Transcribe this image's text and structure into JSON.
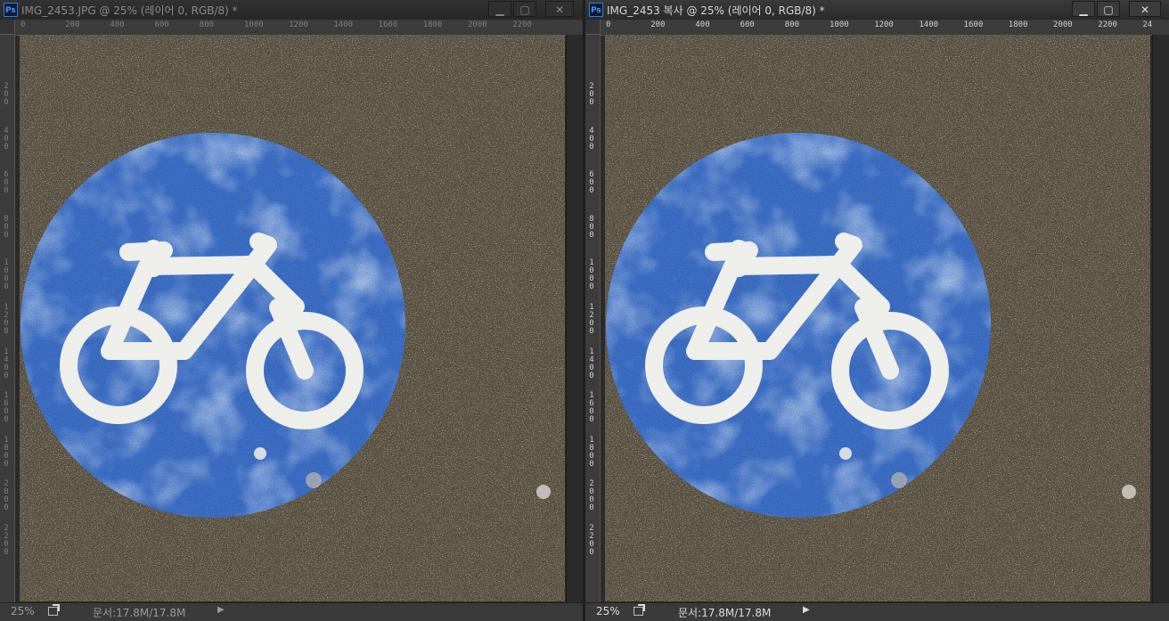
{
  "windows": [
    {
      "title": "IMG_2453.JPG @ 25% (레이어 0, RGB/8) *",
      "zoom": "25%",
      "doc_info": "문서:17.8M/17.8M",
      "ruler_top": [
        "0",
        "200",
        "400",
        "600",
        "800",
        "1000",
        "1200",
        "1400",
        "1600",
        "1800",
        "2000",
        "2200"
      ],
      "ruler_left": [
        "200",
        "400",
        "600",
        "800",
        "1000",
        "1200",
        "1400",
        "1600",
        "1800",
        "2000",
        "2200"
      ],
      "active": false
    },
    {
      "title": "IMG_2453 복사 @ 25% (레이어 0, RGB/8) *",
      "zoom": "25%",
      "doc_info": "문서:17.8M/17.8M",
      "ruler_top": [
        "0",
        "200",
        "400",
        "600",
        "800",
        "1000",
        "1200",
        "1400",
        "1600",
        "1800",
        "2000",
        "2200",
        "24"
      ],
      "ruler_left": [
        "200",
        "400",
        "600",
        "800",
        "1000",
        "1200",
        "1400",
        "1600",
        "1800",
        "2000",
        "2200"
      ],
      "active": true
    }
  ],
  "buttons": {
    "minimize": "▁",
    "maximize": "▢",
    "close": "✕"
  },
  "ps_logo": "Ps",
  "colors": {
    "asphalt": "#605746",
    "sign_blue": "#3d6fc6",
    "sign_white": "#eeeeea"
  },
  "icons": [
    "photoshop-logo-icon",
    "minimize-icon",
    "maximize-icon",
    "close-icon",
    "export-icon",
    "play-icon",
    "bicycle-icon"
  ]
}
